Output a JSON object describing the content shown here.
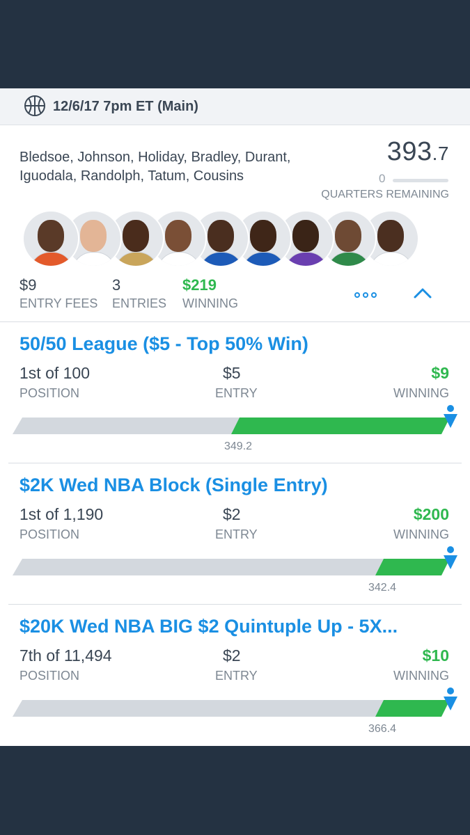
{
  "colors": {
    "accent": "#1a8fe3",
    "positive": "#2fb84f",
    "track": "#d3d8de",
    "text": "#3a4654"
  },
  "header": {
    "icon": "basketball-icon",
    "title": "12/6/17 7pm ET (Main)"
  },
  "lineup": {
    "players_text_line1": "Bledsoe, Johnson, Holiday, Bradley, Durant,",
    "players_text_line2": "Iguodala, Randolph, Tatum, Cousins",
    "score_int": "393",
    "score_dec": ".7",
    "quarters_remaining": "0",
    "quarters_label": "QUARTERS REMAINING",
    "players": [
      {
        "name": "Bledsoe",
        "skin": "#5a3a28",
        "jersey": "#e35a2b"
      },
      {
        "name": "Johnson",
        "skin": "#e3b596",
        "jersey": "#ffffff"
      },
      {
        "name": "Holiday",
        "skin": "#4a2c1c",
        "jersey": "#c9a55b"
      },
      {
        "name": "Bradley",
        "skin": "#7a4f36",
        "jersey": "#ffffff"
      },
      {
        "name": "Durant",
        "skin": "#4a2e1f",
        "jersey": "#1d5bb8"
      },
      {
        "name": "Iguodala",
        "skin": "#3f2618",
        "jersey": "#1d5bb8"
      },
      {
        "name": "Randolph",
        "skin": "#3a2417",
        "jersey": "#6a3fb0"
      },
      {
        "name": "Tatum",
        "skin": "#6e4a34",
        "jersey": "#2f8a4a"
      },
      {
        "name": "Cousins",
        "skin": "#4b2f20",
        "jersey": "#ffffff"
      }
    ],
    "entry_fees_value": "$9",
    "entry_fees_label": "ENTRY FEES",
    "entries_value": "3",
    "entries_label": "ENTRIES",
    "winning_value": "$219",
    "winning_label": "WINNING",
    "more_icon": "more-dots-icon",
    "collapse_icon": "chevron-up-icon"
  },
  "contests": [
    {
      "title": "50/50 League ($5 - Top 50% Win)",
      "position_value": "1st of 100",
      "position_label": "POSITION",
      "entry_value": "$5",
      "entry_label": "ENTRY",
      "winning_value": "$9",
      "winning_label": "WINNING",
      "cutoff": "349.2",
      "cutoff_fraction": 0.5
    },
    {
      "title": "$2K Wed NBA Block (Single Entry)",
      "position_value": "1st of 1,190",
      "position_label": "POSITION",
      "entry_value": "$2",
      "entry_label": "ENTRY",
      "winning_value": "$200",
      "winning_label": "WINNING",
      "cutoff": "342.4",
      "cutoff_fraction": 0.83
    },
    {
      "title": "$20K Wed NBA BIG $2 Quintuple Up - 5X...",
      "position_value": "7th of 11,494",
      "position_label": "POSITION",
      "entry_value": "$2",
      "entry_label": "ENTRY",
      "winning_value": "$10",
      "winning_label": "WINNING",
      "cutoff": "366.4",
      "cutoff_fraction": 0.83
    }
  ]
}
